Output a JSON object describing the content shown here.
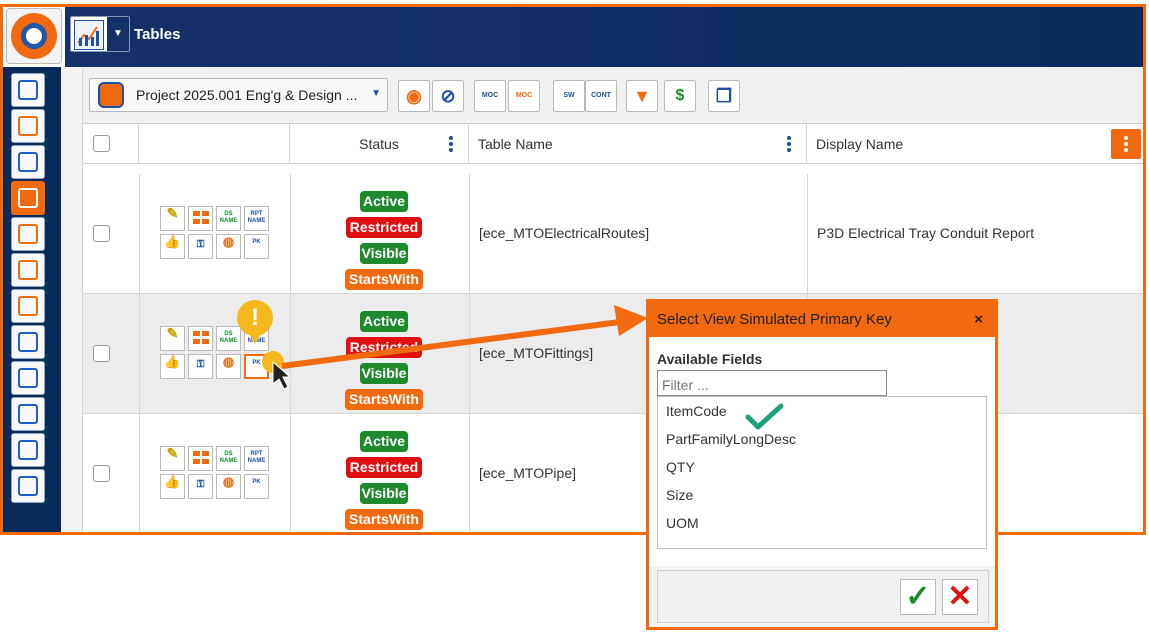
{
  "app": {
    "title": "Tables"
  },
  "toolbar": {
    "project_label": "Project 2025.001 Eng'g & Design ...",
    "buttons": [
      {
        "name": "view-toggle-button",
        "label": "",
        "icon": "eye-icon"
      },
      {
        "name": "hide-toggle-button",
        "label": "",
        "icon": "eye-slash-icon"
      },
      {
        "name": "moc-button",
        "label": "MOC",
        "icon": "moc-icon"
      },
      {
        "name": "moc-alt-button",
        "label": "MOC",
        "icon": "moc-warning-icon"
      },
      {
        "name": "sw-button",
        "label": "SW",
        "icon": "sw-icon"
      },
      {
        "name": "cont-button",
        "label": "CONT",
        "icon": "cont-icon"
      },
      {
        "name": "clear-filter-button",
        "label": "",
        "icon": "filter-clear-icon"
      },
      {
        "name": "refresh-button",
        "label": "",
        "icon": "refresh-dollar-icon"
      },
      {
        "name": "copy-button",
        "label": "",
        "icon": "copy-icon"
      }
    ]
  },
  "table": {
    "headers": {
      "status": "Status",
      "table_name": "Table Name",
      "display_name": "Display Name"
    },
    "rows": [
      {
        "statuses": [
          "Active",
          "Restricted",
          "Visible",
          "StartsWith"
        ],
        "table_name": "[ece_MTOElectricalRoutes]",
        "display_name": "P3D Electrical Tray Conduit Report"
      },
      {
        "statuses": [
          "Active",
          "Restricted",
          "Visible",
          "StartsWith"
        ],
        "table_name": "[ece_MTOFittings]",
        "display_name": ""
      },
      {
        "statuses": [
          "Active",
          "Restricted",
          "Visible",
          "StartsWith"
        ],
        "table_name": "[ece_MTOPipe]",
        "display_name": ""
      }
    ],
    "row_icons": {
      "ds": "DS NAME",
      "rpt": "RPT NAME",
      "pk": "PK"
    }
  },
  "callout": {
    "symbol": "!"
  },
  "dialog": {
    "title": "Select View Simulated Primary Key",
    "close": "×",
    "available_label": "Available Fields",
    "filter_placeholder": "Filter ...",
    "fields": [
      "ItemCode",
      "PartFamilyLongDesc",
      "QTY",
      "Size",
      "UOM"
    ],
    "ok": "✓",
    "cancel": "✕"
  },
  "colors": {
    "accent": "#f26a10",
    "header": "#0b2a5c",
    "active": "#1f8a2d",
    "restricted": "#e01010"
  }
}
